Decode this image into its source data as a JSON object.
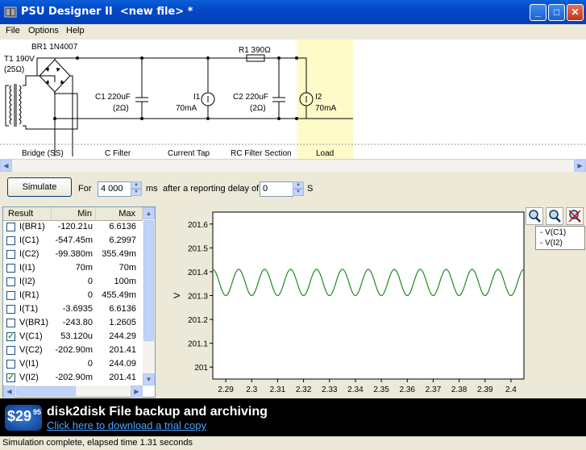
{
  "window": {
    "title": "PSU Designer II  <new file> *",
    "controls": [
      "_",
      "□",
      "✕"
    ]
  },
  "menu": [
    "File",
    "Options",
    "Help"
  ],
  "schematic": {
    "transformer": {
      "label": "T1 190V",
      "sub": "(25Ω)",
      "section": "Bridge (SS)"
    },
    "bridge": {
      "label": "BR1 1N4007"
    },
    "c1": {
      "label": "C1 220uF",
      "sub": "(2Ω)",
      "section": "C Filter"
    },
    "i1": {
      "label": "I1",
      "sub": "70mA",
      "section": "Current Tap"
    },
    "r1": {
      "label": "R1 390Ω"
    },
    "c2": {
      "label": "C2 220uF",
      "sub": "(2Ω)",
      "section": "RC Filter Section"
    },
    "i2": {
      "label": "I2",
      "sub": "70mA",
      "section": "Load"
    },
    "load_color": "#fffbc9"
  },
  "controls": {
    "simulate_label": "Simulate",
    "for_label": "For",
    "duration_value": "4 000",
    "ms_label": "ms",
    "delay_label": "after a reporting delay of",
    "delay_value": "0",
    "s_label": "S"
  },
  "results": {
    "headers": [
      "Result",
      "Min",
      "Max"
    ],
    "rows": [
      {
        "name": "I(BR1)",
        "min": "-120.21u",
        "max": "6.6136",
        "checked": false
      },
      {
        "name": "I(C1)",
        "min": "-547.45m",
        "max": "6.2997",
        "checked": false
      },
      {
        "name": "I(C2)",
        "min": "-99.380m",
        "max": "355.49m",
        "checked": false
      },
      {
        "name": "I(I1)",
        "min": "70m",
        "max": "70m",
        "checked": false
      },
      {
        "name": "I(I2)",
        "min": "0",
        "max": "100m",
        "checked": false
      },
      {
        "name": "I(R1)",
        "min": "0",
        "max": "455.49m",
        "checked": false
      },
      {
        "name": "I(T1)",
        "min": "-3.6935",
        "max": "6.6136",
        "checked": false
      },
      {
        "name": "V(BR1)",
        "min": "-243.80",
        "max": "1.2605",
        "checked": false
      },
      {
        "name": "V(C1)",
        "min": "53.120u",
        "max": "244.29",
        "checked": true
      },
      {
        "name": "V(C2)",
        "min": "-202.90m",
        "max": "201.41",
        "checked": false
      },
      {
        "name": "V(I1)",
        "min": "0",
        "max": "244.09",
        "checked": false
      },
      {
        "name": "V(I2)",
        "min": "-202.90m",
        "max": "201.41",
        "checked": true
      }
    ]
  },
  "chart_data": {
    "type": "line",
    "ylabel": "V",
    "xlim": [
      2.285,
      2.405
    ],
    "ylim": [
      200.95,
      201.65
    ],
    "x_ticks": [
      "2.29",
      "2.3",
      "2.31",
      "2.32",
      "2.33",
      "2.34",
      "2.35",
      "2.36",
      "2.37",
      "2.38",
      "2.39",
      "2.4"
    ],
    "y_ticks": [
      "201.6",
      "201.5",
      "201.4",
      "201.3",
      "201.2",
      "201.1",
      "201"
    ],
    "grid": false,
    "legend_placement": "top-right",
    "legend": [
      "V(C1)",
      "V(I2)"
    ],
    "series": [
      {
        "name": "V(I2)",
        "color": "#1e8c1e",
        "mean": 201.355,
        "amplitude": 0.055,
        "period": 0.01,
        "cycles_from": 2.285,
        "cycles_to": 2.405
      }
    ]
  },
  "banner": {
    "price": "$29",
    "price_cents": "95",
    "headline": "disk2disk File backup and archiving",
    "link": "Click here to download a trial copy"
  },
  "status": "Simulation complete, elapsed time 1.31 seconds"
}
